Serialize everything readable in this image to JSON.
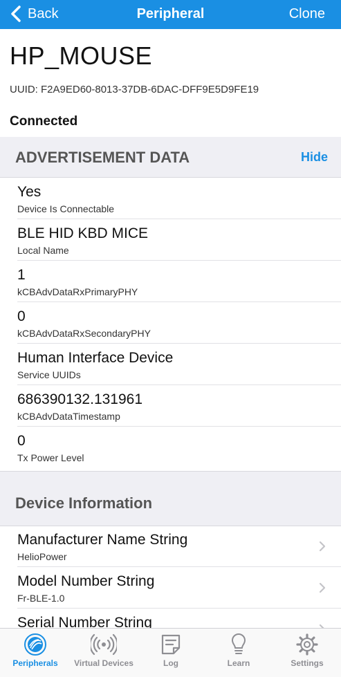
{
  "nav": {
    "back_label": "Back",
    "title": "Peripheral",
    "clone_label": "Clone"
  },
  "peripheral": {
    "name": "HP_MOUSE",
    "uuid": "UUID: F2A9ED60-8013-37DB-6DAC-DFF9E5D9FE19",
    "status": "Connected"
  },
  "advertisement": {
    "header": "ADVERTISEMENT DATA",
    "hide_label": "Hide",
    "items": [
      {
        "value": "Yes",
        "key": "Device Is Connectable"
      },
      {
        "value": "BLE HID KBD MICE",
        "key": "Local Name"
      },
      {
        "value": "1",
        "key": "kCBAdvDataRxPrimaryPHY"
      },
      {
        "value": "0",
        "key": "kCBAdvDataRxSecondaryPHY"
      },
      {
        "value": "Human Interface Device",
        "key": "Service UUIDs"
      },
      {
        "value": "686390132.131961",
        "key": "kCBAdvDataTimestamp"
      },
      {
        "value": "0",
        "key": "Tx Power Level"
      }
    ]
  },
  "device_info": {
    "header": "Device Information",
    "items": [
      {
        "name": "Manufacturer Name String",
        "value": "HelioPower"
      },
      {
        "name": "Model Number String",
        "value": "Fr-BLE-1.0"
      },
      {
        "name": "Serial Number String",
        "value": ""
      }
    ]
  },
  "tabs": [
    {
      "label": "Peripherals",
      "icon": "peripherals-icon",
      "active": true
    },
    {
      "label": "Virtual Devices",
      "icon": "broadcast-icon",
      "active": false
    },
    {
      "label": "Log",
      "icon": "log-icon",
      "active": false
    },
    {
      "label": "Learn",
      "icon": "lightbulb-icon",
      "active": false
    },
    {
      "label": "Settings",
      "icon": "gear-icon",
      "active": false
    }
  ],
  "colors": {
    "accent": "#1a8fe3",
    "section_bg": "#efeff4",
    "inactive_tab": "#8e8e93"
  }
}
